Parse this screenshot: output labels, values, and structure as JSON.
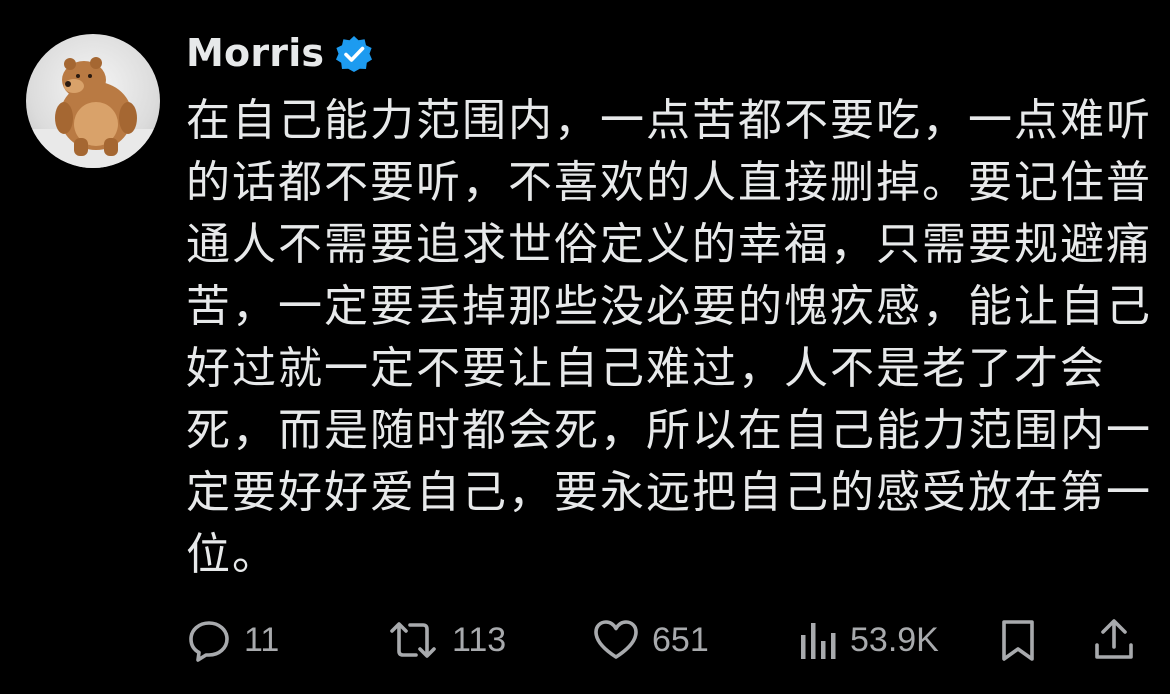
{
  "user": {
    "display_name": "Morris",
    "verified": true,
    "verified_color": "#1d9bf0",
    "avatar_icon": "bear-avatar"
  },
  "post": {
    "lines": [
      "在自己能力范围内，一点苦都不要吃，一点难听",
      "的话都不要听，不喜欢的人直接删掉。要记住普",
      "通人不需要追求世俗定义的幸福，只需要规避痛",
      "苦，一定要丢掉那些没必要的愧疚感，能让自己",
      "好过就一定不要让自己难过，人不是老了才会",
      "死，而是随时都会死，所以在自己能力范围内一",
      "定要好好爱自己，要永远把自己的感受放在第一",
      "位。"
    ]
  },
  "actions": {
    "reply": {
      "icon": "reply-icon",
      "count": "11"
    },
    "repost": {
      "icon": "repost-icon",
      "count": "113"
    },
    "like": {
      "icon": "heart-icon",
      "count": "651"
    },
    "views": {
      "icon": "views-icon",
      "count": "53.9K"
    },
    "bookmark": {
      "icon": "bookmark-icon"
    },
    "share": {
      "icon": "share-icon"
    }
  },
  "colors": {
    "background": "#000000",
    "text": "#e7e9ea",
    "secondary": "#a8aaad"
  }
}
